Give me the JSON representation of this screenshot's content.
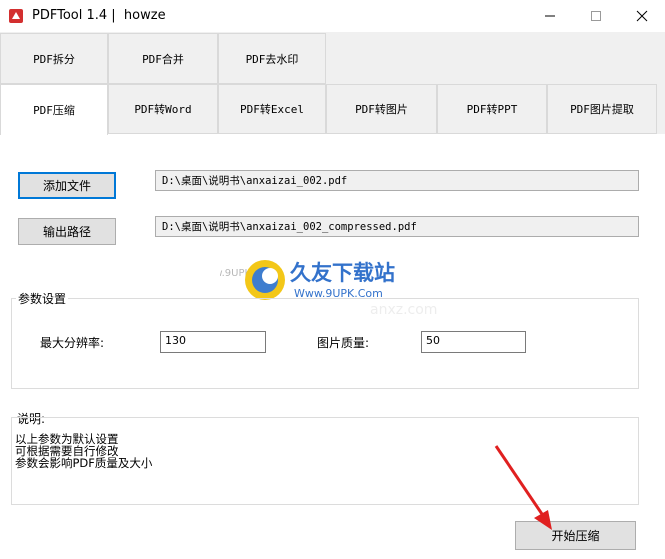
{
  "window": {
    "title": "PDFTool 1.4 |  howze",
    "controls": {
      "minimize": "minimize-icon",
      "maximize": "maximize-icon",
      "close": "close-icon"
    }
  },
  "tabs": {
    "row1": [
      "PDF拆分",
      "PDF合并",
      "PDF去水印"
    ],
    "row2": [
      "PDF压缩",
      "PDF转Word",
      "PDF转Excel",
      "PDF转图片",
      "PDF转PPT",
      "PDF图片提取"
    ],
    "active": "PDF压缩"
  },
  "files": {
    "add_button": "添加文件",
    "input_path": "D:\\桌面\\说明书\\anxaizai_002.pdf",
    "output_button": "输出路径",
    "output_path": "D:\\桌面\\说明书\\anxaizai_002_compressed.pdf"
  },
  "params": {
    "group_label": "参数设置",
    "resolution_label": "最大分辨率:",
    "resolution_value": "130",
    "quality_label": "图片质量:",
    "quality_value": "50"
  },
  "notes": {
    "group_label": "说明:",
    "text": "以上参数为默认设置\n可根据需要自行修改\n参数会影响PDF质量及大小"
  },
  "actions": {
    "start_button": "开始压缩"
  },
  "watermark": {
    "site": "www.9UPK.com",
    "brand": "久友下载站",
    "url": "Www.9UPK.Com",
    "small": "anxz.com"
  },
  "colors": {
    "accent": "#0078d7",
    "arrow": "#e02020"
  }
}
